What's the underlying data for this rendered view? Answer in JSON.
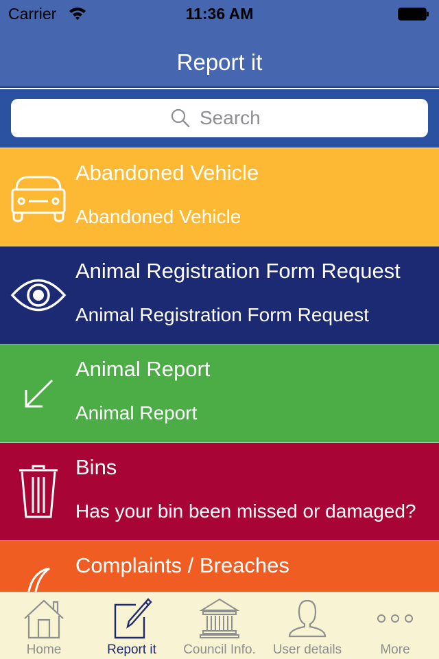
{
  "status_bar": {
    "carrier": "Carrier",
    "time": "11:36 AM",
    "wifi_icon": "wifi-icon",
    "battery_icon": "battery-full-icon"
  },
  "nav": {
    "title": "Report it"
  },
  "search": {
    "placeholder": "Search",
    "value": "",
    "icon": "search-icon"
  },
  "colors": {
    "header": "#4766b0",
    "search_bar": "#2b52a1",
    "tabbar": "#f8f3d2",
    "tab_active": "#1e2a6e",
    "tab_inactive": "#8e8e8e"
  },
  "items": [
    {
      "title": "Abandoned Vehicle",
      "subtitle": "Abandoned Vehicle",
      "icon": "car-icon",
      "color": "#fdb933"
    },
    {
      "title": "Animal Registration Form Request",
      "subtitle": "Animal Registration Form Request",
      "icon": "eye-icon",
      "color": "#1c2a73"
    },
    {
      "title": "Animal Report",
      "subtitle": "Animal Report",
      "icon": "arrow-down-left-icon",
      "color": "#4cad47"
    },
    {
      "title": "Bins",
      "subtitle": "Has your bin been missed or damaged?",
      "icon": "trash-bin-icon",
      "color": "#a80436"
    },
    {
      "title": "Complaints / Breaches",
      "subtitle": "",
      "icon": "crescent-icon",
      "color": "#f05d23"
    }
  ],
  "tabs": [
    {
      "label": "Home",
      "icon": "home-icon",
      "active": false
    },
    {
      "label": "Report it",
      "icon": "edit-icon",
      "active": true
    },
    {
      "label": "Council Info.",
      "icon": "building-icon",
      "active": false
    },
    {
      "label": "User details",
      "icon": "user-icon",
      "active": false
    },
    {
      "label": "More",
      "icon": "more-icon",
      "active": false
    }
  ]
}
